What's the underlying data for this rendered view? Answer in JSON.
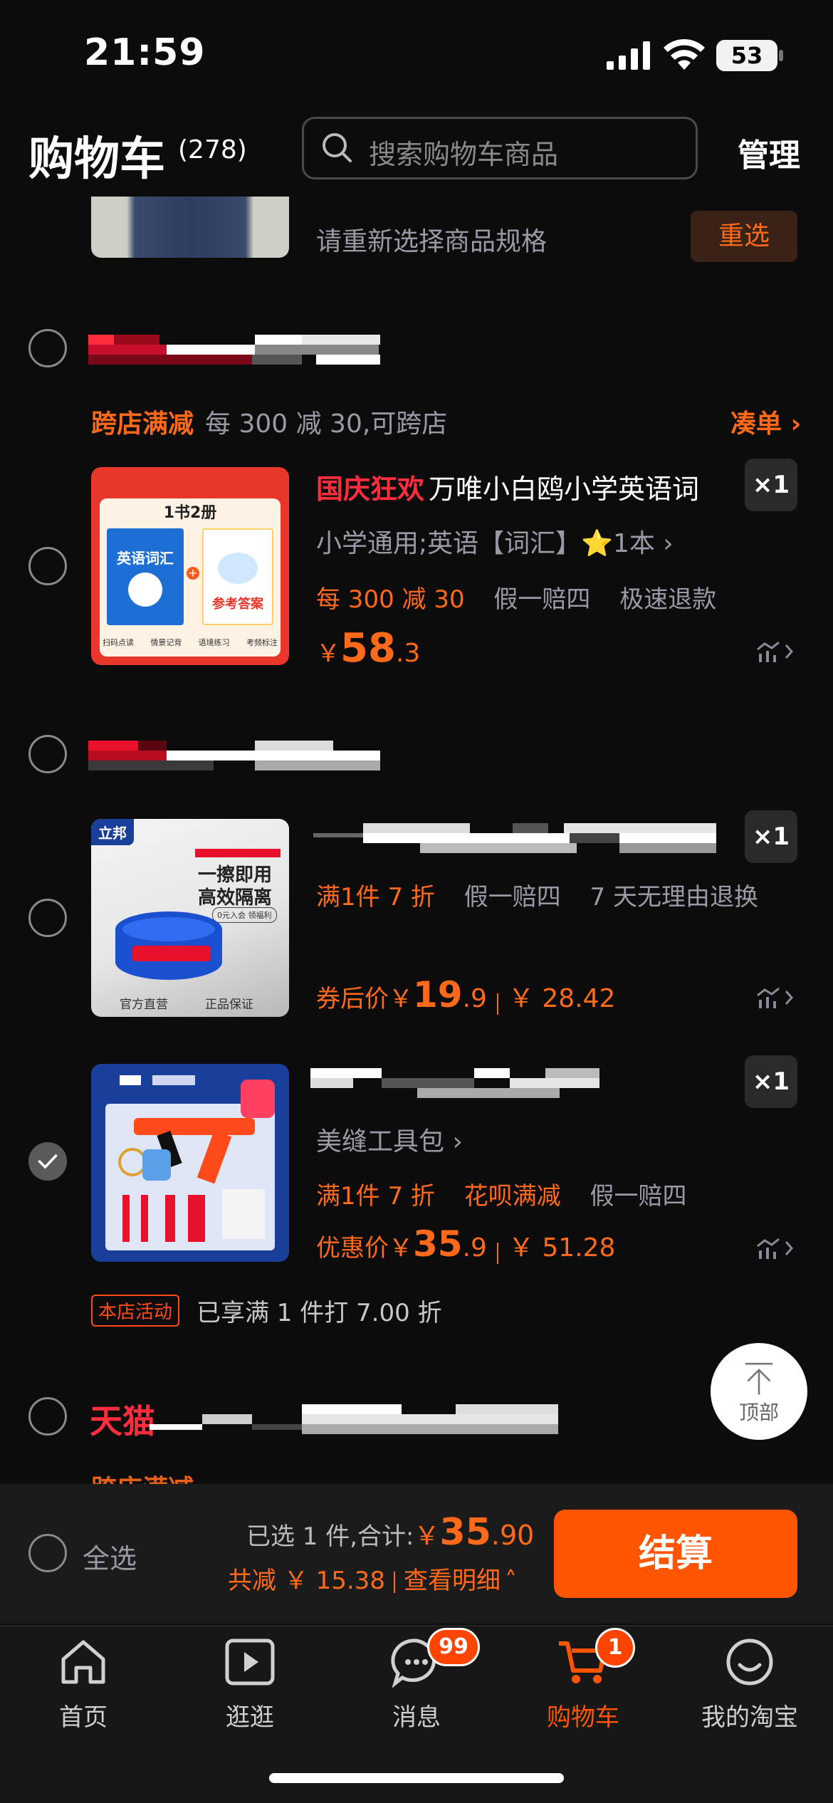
{
  "status_bar": {
    "time": "21:59",
    "battery": "53",
    "battery_level": 0.53
  },
  "header": {
    "title": "购物车",
    "count": "(278)",
    "search_placeholder": "搜索购物车商品",
    "manage": "管理"
  },
  "partial_item": {
    "notice": "请重新选择商品规格",
    "reselect": "重选"
  },
  "store1": {
    "promo_tag": "跨店满减",
    "promo_desc": "每 300 减 30,可跨店",
    "promo_link": "凑单",
    "item": {
      "highlight": "国庆狂欢",
      "title": "万唯小白鸥小学英语词",
      "spec": "小学通用;英语【词汇】⭐1本",
      "tags": [
        "每 300 减 30",
        "假一赔四",
        "极速退款"
      ],
      "price_symbol": "￥",
      "price_int": "58",
      "price_dec": ".3",
      "qty": "×1",
      "thumb": {
        "top_label": "1书2册",
        "left_title": "英语词汇",
        "right_title": "参考答案",
        "footer": [
          "扫码点读",
          "情景记背",
          "语境练习",
          "考频标注"
        ]
      }
    }
  },
  "store2": {
    "items": [
      {
        "tags": [
          "满1件 7 折",
          "假一赔四",
          "7 天无理由退换"
        ],
        "price_label": "券后价",
        "price_symbol": "￥",
        "price_int": "19",
        "price_dec": ".9",
        "orig_price": "￥ 28.42",
        "qty": "×1",
        "thumb": {
          "brand": "立邦",
          "headline1": "一擦即用",
          "headline2": "高效隔离",
          "badge": "0元入会 领福利",
          "footer1": "官方直营",
          "footer2": "正品保证"
        }
      },
      {
        "spec": "美缝工具包",
        "tags": [
          "满1件 7 折",
          "花呗满减",
          "假一赔四"
        ],
        "price_label": "优惠价",
        "price_symbol": "￥",
        "price_int": "35",
        "price_dec": ".9",
        "orig_price": "￥ 51.28",
        "qty": "×1"
      }
    ],
    "activity_tag": "本店活动",
    "activity_desc": "已享满 1 件打 7.00 折"
  },
  "store3": {
    "brand": "天猫"
  },
  "back_top": "顶部",
  "checkout": {
    "select_all": "全选",
    "selected_text": "已选 1 件,合计:",
    "total_symbol": "￥",
    "total_int": "35",
    "total_dec": ".90",
    "discount_text": "共减 ￥ 15.38",
    "detail_link": "查看明细",
    "button": "结算"
  },
  "tabs": [
    {
      "label": "首页",
      "icon": "home-icon"
    },
    {
      "label": "逛逛",
      "icon": "video-icon"
    },
    {
      "label": "消息",
      "icon": "message-icon",
      "badge": "99"
    },
    {
      "label": "购物车",
      "icon": "cart-icon",
      "badge": "1",
      "active": true
    },
    {
      "label": "我的淘宝",
      "icon": "profile-icon"
    }
  ],
  "colors": {
    "accent": "#ff6a1a",
    "highlight_red": "#ff2d3d",
    "background": "#0c0c0c"
  }
}
